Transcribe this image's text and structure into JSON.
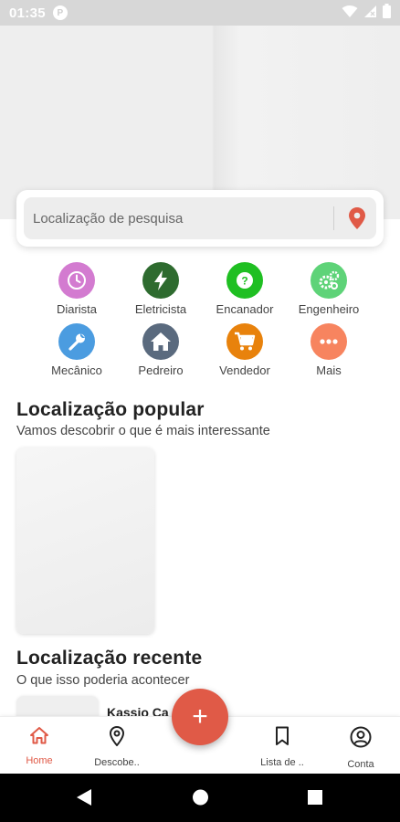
{
  "status_bar": {
    "time": "01:35",
    "app_badge": "P"
  },
  "hero": {
    "slides": 2,
    "active_slide": 0
  },
  "search": {
    "placeholder": "Localização de pesquisa",
    "value": ""
  },
  "categories": [
    {
      "label": "Diarista",
      "icon": "clock-icon",
      "color": "#d37bd0"
    },
    {
      "label": "Eletricista",
      "icon": "bolt-icon",
      "color": "#2e6b2f"
    },
    {
      "label": "Encanador",
      "icon": "question-icon",
      "color": "#1fbf22"
    },
    {
      "label": "Engenheiro",
      "icon": "gears-icon",
      "color": "#5ed378"
    },
    {
      "label": "Mecânico",
      "icon": "wrench-icon",
      "color": "#4b9ce0"
    },
    {
      "label": "Pedreiro",
      "icon": "home-icon",
      "color": "#5a6a7e"
    },
    {
      "label": "Vendedor",
      "icon": "cart-icon",
      "color": "#e8820c"
    },
    {
      "label": "Mais",
      "icon": "more-icon",
      "color": "#f7845f"
    }
  ],
  "popular": {
    "title": "Localização popular",
    "subtitle": "Vamos descobrir o que é mais interessante"
  },
  "recent": {
    "title": "Localização recente",
    "subtitle": "O que isso poderia acontecer",
    "first_item_name": "Kassio Ca"
  },
  "fab": {
    "label": "+"
  },
  "bottom_nav": [
    {
      "label": "Home",
      "icon": "home-icon",
      "active": true
    },
    {
      "label": "Descobe..",
      "icon": "map-pin-icon",
      "active": false
    },
    {
      "label": "Lista de ..",
      "icon": "bookmark-icon",
      "active": false
    },
    {
      "label": "Conta",
      "icon": "account-icon",
      "active": false
    }
  ],
  "colors": {
    "accent": "#e05a47",
    "status_bar": "#d7d7d7"
  }
}
